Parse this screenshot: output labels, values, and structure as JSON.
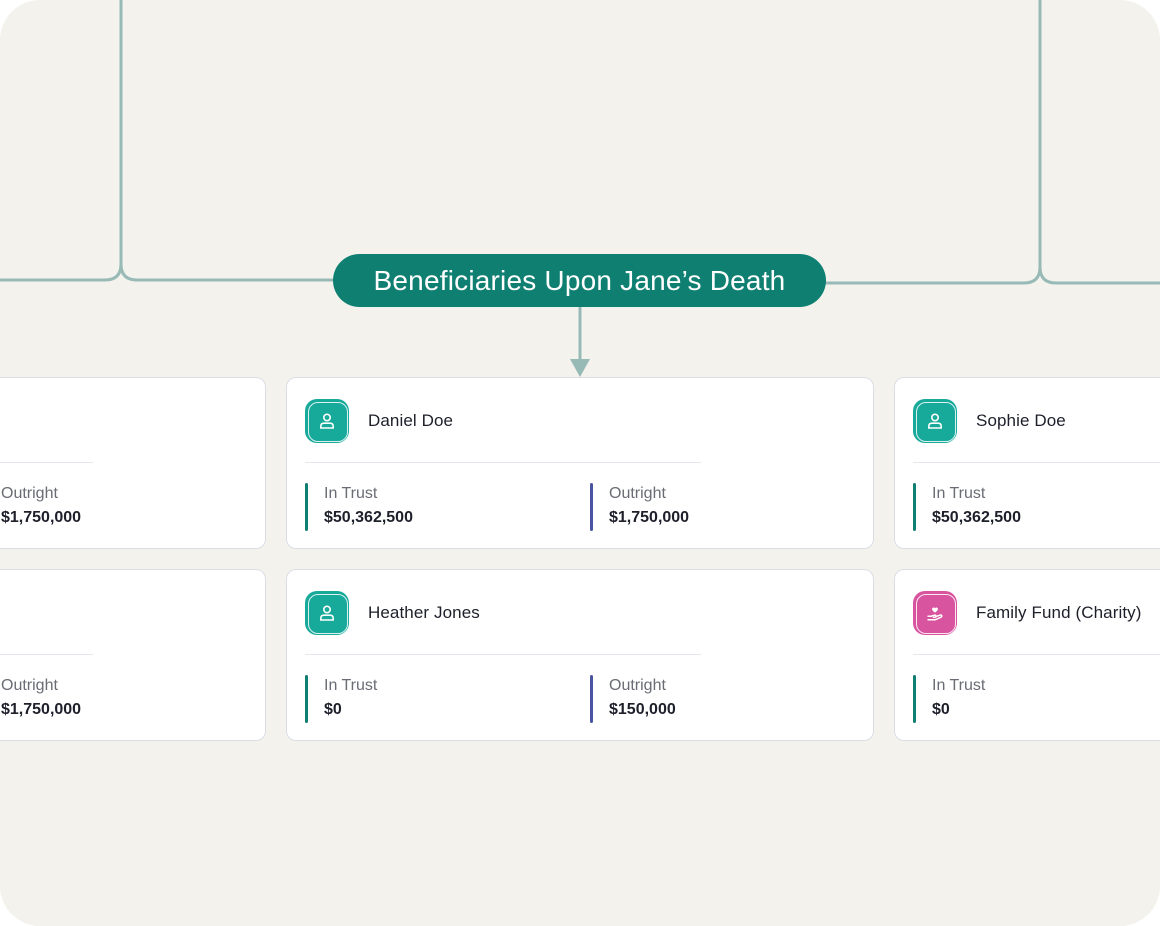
{
  "title": "Beneficiaries Upon Jane’s Death",
  "colors": {
    "background": "#f3f2ed",
    "title_pill": "#0f7f72",
    "connector": "#98bab6",
    "trust_bar": "#0f7f72",
    "outright_bar": "#4a55a2",
    "person_icon_bg": "#17a99a",
    "charity_icon_bg": "#d9549e"
  },
  "cards": {
    "left_top": {
      "metrics": [
        {
          "label": "Outright",
          "value": "$1,750,000"
        }
      ]
    },
    "left_bottom": {
      "metrics": [
        {
          "label": "Outright",
          "value": "$1,750,000"
        }
      ]
    },
    "daniel": {
      "name": "Daniel Doe",
      "icon": "person-icon",
      "metrics": [
        {
          "label": "In Trust",
          "value": "$50,362,500"
        },
        {
          "label": "Outright",
          "value": "$1,750,000"
        }
      ]
    },
    "heather": {
      "name": "Heather Jones",
      "icon": "person-icon",
      "metrics": [
        {
          "label": "In Trust",
          "value": "$0"
        },
        {
          "label": "Outright",
          "value": "$150,000"
        }
      ]
    },
    "sophie": {
      "name": "Sophie Doe",
      "icon": "person-icon",
      "metrics": [
        {
          "label": "In Trust",
          "value": "$50,362,500"
        }
      ]
    },
    "family_fund": {
      "name": "Family Fund (Charity)",
      "icon": "charity-hand-heart-icon",
      "metrics": [
        {
          "label": "In Trust",
          "value": "$0"
        }
      ]
    }
  }
}
